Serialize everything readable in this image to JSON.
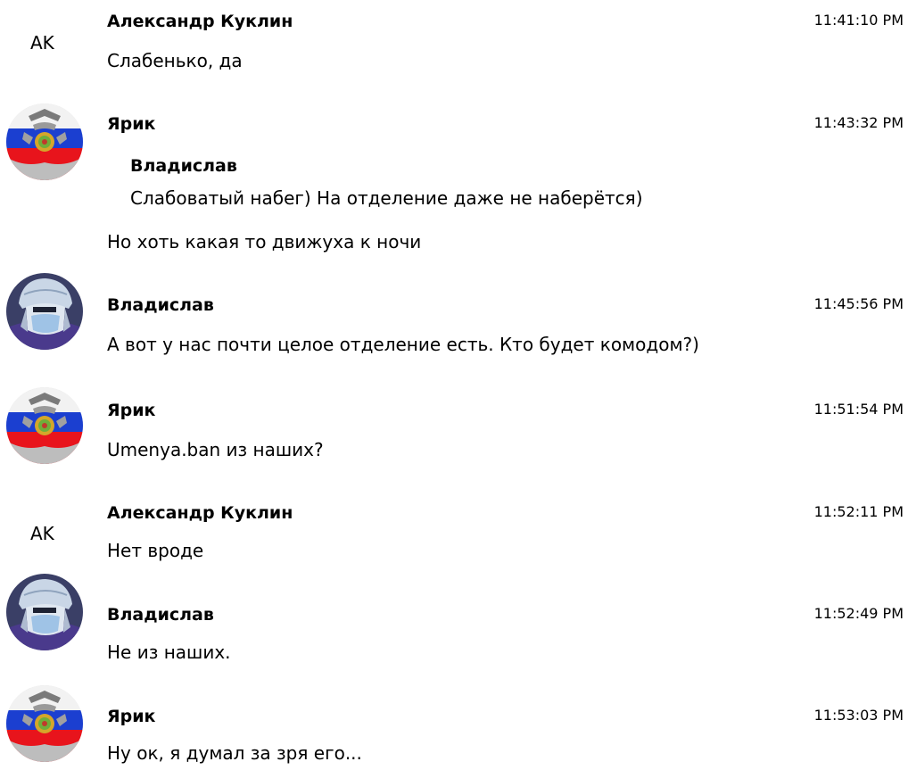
{
  "messages": [
    {
      "author": "Александр Куклин",
      "initials": "AK",
      "time": "11:41:10 PM",
      "text": "Слабенько, да",
      "avatar": "initials"
    },
    {
      "author": "Ярик",
      "time": "11:43:32 PM",
      "avatar": "emblem-flag-avatar",
      "quote": {
        "author": "Владислав",
        "text": "Слабоватый набег) На отделение даже не наберётся)"
      },
      "text": "Но хоть какая то движуха к ночи"
    },
    {
      "author": "Владислав",
      "time": "11:45:56 PM",
      "avatar": "helmet-warrior-avatar",
      "text": "А вот у нас почти целое отделение есть. Кто будет комодом?)"
    },
    {
      "author": "Ярик",
      "time": "11:51:54 PM",
      "avatar": "emblem-flag-avatar",
      "text": "Umenya.ban из наших?"
    },
    {
      "author": "Александр Куклин",
      "initials": "AK",
      "time": "11:52:11 PM",
      "avatar": "initials",
      "text": "Нет вроде"
    },
    {
      "author": "Владислав",
      "time": "11:52:49 PM",
      "avatar": "helmet-warrior-avatar",
      "text": "Не из наших."
    },
    {
      "author": "Ярик",
      "time": "11:53:03 PM",
      "avatar": "emblem-flag-avatar",
      "text": "Ну ок, я думал за зря его..."
    }
  ],
  "colors": {
    "flag_white": "#f4f4f4",
    "flag_blue": "#1b3fd0",
    "flag_red": "#e8141c",
    "helmet_bg": "#3a3f66",
    "helmet_metal": "#c9d6e6",
    "mask": "#9fc3e6",
    "armor_purple": "#4a3a8c"
  }
}
